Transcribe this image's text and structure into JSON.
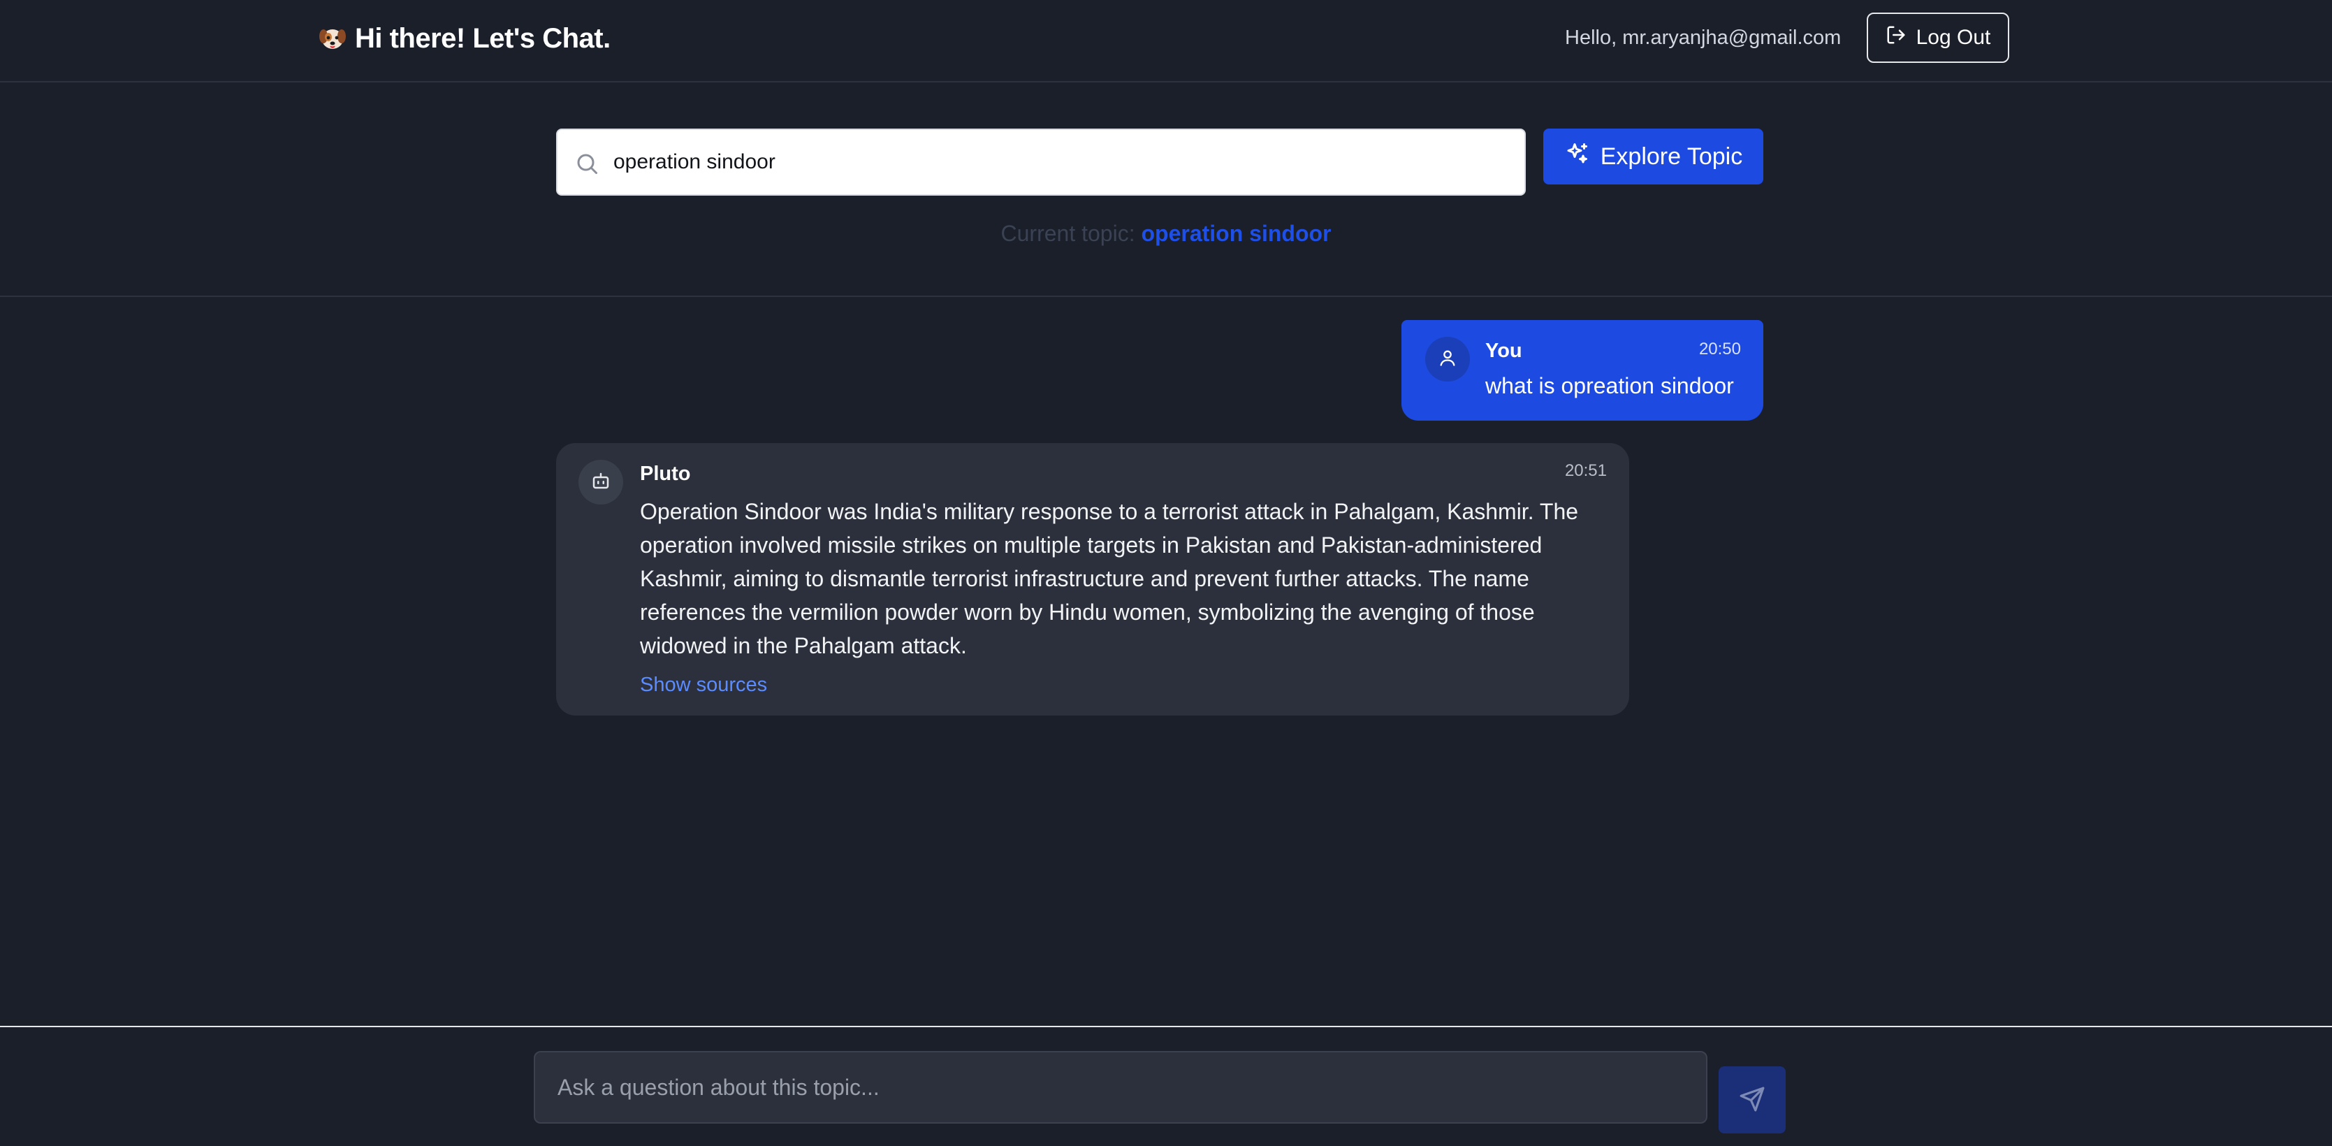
{
  "header": {
    "brand_icon": "dog-face-icon",
    "title": "Hi there! Let's Chat.",
    "greeting": "Hello, mr.aryanjha@gmail.com",
    "logout_label": "Log Out",
    "logout_icon": "logout-icon"
  },
  "topic": {
    "search_value": "operation sindoor",
    "search_icon": "search-icon",
    "explore_label": "Explore Topic",
    "explore_icon": "sparkles-icon",
    "current_label": "Current topic:",
    "current_value": "operation sindoor"
  },
  "messages": [
    {
      "sender": "You",
      "time": "20:50",
      "text": "what is opreation sindoor",
      "avatar_icon": "user-icon"
    },
    {
      "sender": "Pluto",
      "time": "20:51",
      "text": "Operation Sindoor was India's military response to a terrorist attack in Pahalgam, Kashmir.  The operation involved missile strikes on multiple targets in Pakistan and Pakistan-administered Kashmir, aiming to dismantle terrorist infrastructure and prevent further attacks.  The name references the vermilion powder worn by Hindu women, symbolizing the avenging of those widowed in the Pahalgam attack.",
      "avatar_icon": "bot-icon",
      "sources_label": "Show sources"
    }
  ],
  "composer": {
    "placeholder": "Ask a question about this topic...",
    "send_icon": "send-icon"
  },
  "colors": {
    "background": "#1b1f2a",
    "accent": "#1d4ae0",
    "bot_bubble": "#2c303d",
    "link": "#5b8cff"
  }
}
